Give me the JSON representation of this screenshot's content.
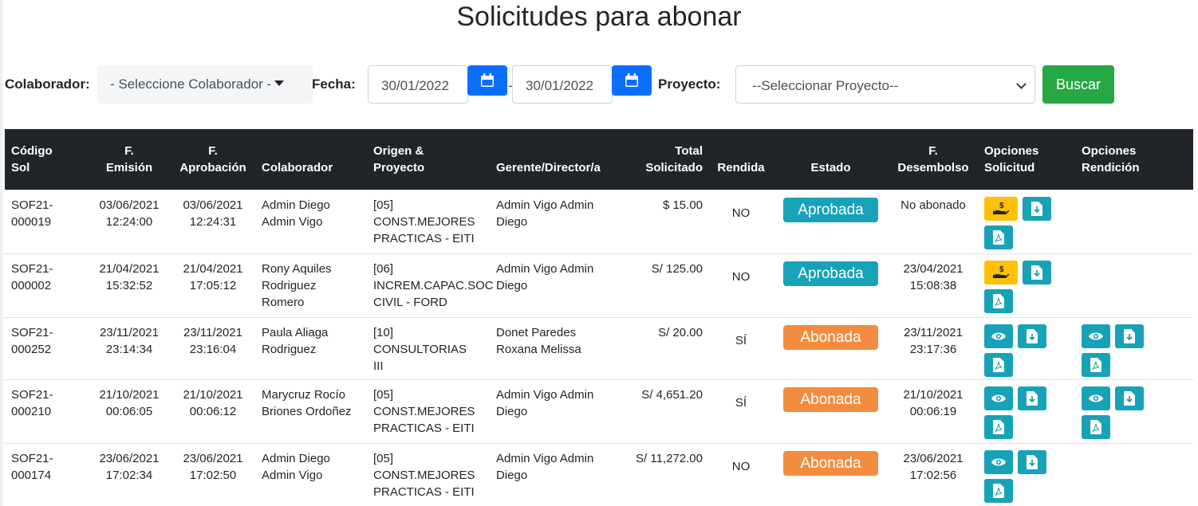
{
  "page": {
    "title": "Solicitudes para abonar"
  },
  "filters": {
    "colaborador_label": "Colaborador:",
    "colaborador_value": "- Seleccione Colaborador -",
    "fecha_label": "Fecha:",
    "fecha_desde": "30/01/2022",
    "fecha_separator": "-",
    "fecha_hasta": "30/01/2022",
    "proyecto_label": "Proyecto:",
    "proyecto_value": "--Seleccionar Proyecto--",
    "buscar_label": "Buscar"
  },
  "colors": {
    "primary": "#0d6efd",
    "success": "#28a745",
    "info": "#17a2b8",
    "warning": "#ffc107",
    "orange": "#f38c3e",
    "header": "#212529"
  },
  "table": {
    "headers": {
      "codigo": [
        "Código",
        "Sol"
      ],
      "emision": [
        "F.",
        "Emisión"
      ],
      "aprobacion": [
        "F.",
        "Aprobación"
      ],
      "colaborador": [
        "Colaborador"
      ],
      "origen": [
        "Origen &",
        "Proyecto"
      ],
      "gerente": [
        "Gerente/Director/a"
      ],
      "total": [
        "Total",
        "Solicitado"
      ],
      "rendida": [
        "Rendida"
      ],
      "estado": [
        "Estado"
      ],
      "desembolso": [
        "F.",
        "Desembolso"
      ],
      "opc_solicitud": [
        "Opciones",
        "Solicitud"
      ],
      "opc_rendicion": [
        "Opciones",
        "Rendición"
      ]
    },
    "rows": [
      {
        "codigo": [
          "SOF21-",
          "000019"
        ],
        "emision": [
          "03/06/2021",
          "12:24:00"
        ],
        "aprobacion": [
          "03/06/2021",
          "12:24:31"
        ],
        "colaborador": [
          "Admin Diego",
          "Admin Vigo"
        ],
        "origen": [
          "[05]",
          "CONST.MEJORES",
          "PRACTICAS - EITI"
        ],
        "gerente": [
          "Admin Vigo Admin",
          "Diego"
        ],
        "total": "$ 15.00",
        "rendida": "NO",
        "estado": "Aprobada",
        "estado_color": "#17a2b8",
        "desembolso": [
          "No abonado"
        ],
        "sol_icons": [
          "hand-money-icon",
          "download-icon",
          "pdf-icon"
        ],
        "ren_icons": []
      },
      {
        "codigo": [
          "SOF21-",
          "000002"
        ],
        "emision": [
          "21/04/2021",
          "15:32:52"
        ],
        "aprobacion": [
          "21/04/2021",
          "17:05:12"
        ],
        "colaborador": [
          "Rony Aquiles",
          "Rodriguez",
          "Romero"
        ],
        "origen": [
          "[06]",
          "INCREM.CAPAC.SOC",
          "CIVIL - FORD"
        ],
        "gerente": [
          "Admin Vigo Admin",
          "Diego"
        ],
        "total": "S/ 125.00",
        "rendida": "NO",
        "estado": "Aprobada",
        "estado_color": "#17a2b8",
        "desembolso": [
          "23/04/2021",
          "15:08:38"
        ],
        "sol_icons": [
          "hand-money-icon",
          "download-icon",
          "pdf-icon"
        ],
        "ren_icons": []
      },
      {
        "codigo": [
          "SOF21-",
          "000252"
        ],
        "emision": [
          "23/11/2021",
          "23:14:34"
        ],
        "aprobacion": [
          "23/11/2021",
          "23:16:04"
        ],
        "colaborador": [
          "Paula Aliaga",
          "Rodriguez"
        ],
        "origen": [
          "[10] CONSULTORIAS",
          "III"
        ],
        "gerente": [
          "Donet Paredes",
          "Roxana Melissa"
        ],
        "total": "S/ 20.00",
        "rendida": "SÍ",
        "estado": "Abonada",
        "estado_color": "#f38c3e",
        "desembolso": [
          "23/11/2021",
          "23:17:36"
        ],
        "sol_icons": [
          "eye-icon",
          "download-icon",
          "pdf-icon"
        ],
        "ren_icons": [
          "eye-icon",
          "download-icon",
          "pdf-icon"
        ]
      },
      {
        "codigo": [
          "SOF21-",
          "000210"
        ],
        "emision": [
          "21/10/2021",
          "00:06:05"
        ],
        "aprobacion": [
          "21/10/2021",
          "00:06:12"
        ],
        "colaborador": [
          "Marycruz Rocío",
          "Briones Ordoñez"
        ],
        "origen": [
          "[05]",
          "CONST.MEJORES",
          "PRACTICAS - EITI"
        ],
        "gerente": [
          "Admin Vigo Admin",
          "Diego"
        ],
        "total": "S/ 4,651.20",
        "rendida": "SÍ",
        "estado": "Abonada",
        "estado_color": "#f38c3e",
        "desembolso": [
          "21/10/2021",
          "00:06:19"
        ],
        "sol_icons": [
          "eye-icon",
          "download-icon",
          "pdf-icon"
        ],
        "ren_icons": [
          "eye-icon",
          "download-icon",
          "pdf-icon"
        ]
      },
      {
        "codigo": [
          "SOF21-",
          "000174"
        ],
        "emision": [
          "23/06/2021",
          "17:02:34"
        ],
        "aprobacion": [
          "23/06/2021",
          "17:02:50"
        ],
        "colaborador": [
          "Admin Diego",
          "Admin Vigo"
        ],
        "origen": [
          "[05]",
          "CONST.MEJORES",
          "PRACTICAS - EITI"
        ],
        "gerente": [
          "Admin Vigo Admin",
          "Diego"
        ],
        "total": "S/ 11,272.00",
        "rendida": "NO",
        "estado": "Abonada",
        "estado_color": "#f38c3e",
        "desembolso": [
          "23/06/2021",
          "17:02:56"
        ],
        "sol_icons": [
          "eye-icon",
          "download-icon",
          "pdf-icon"
        ],
        "ren_icons": []
      }
    ]
  }
}
